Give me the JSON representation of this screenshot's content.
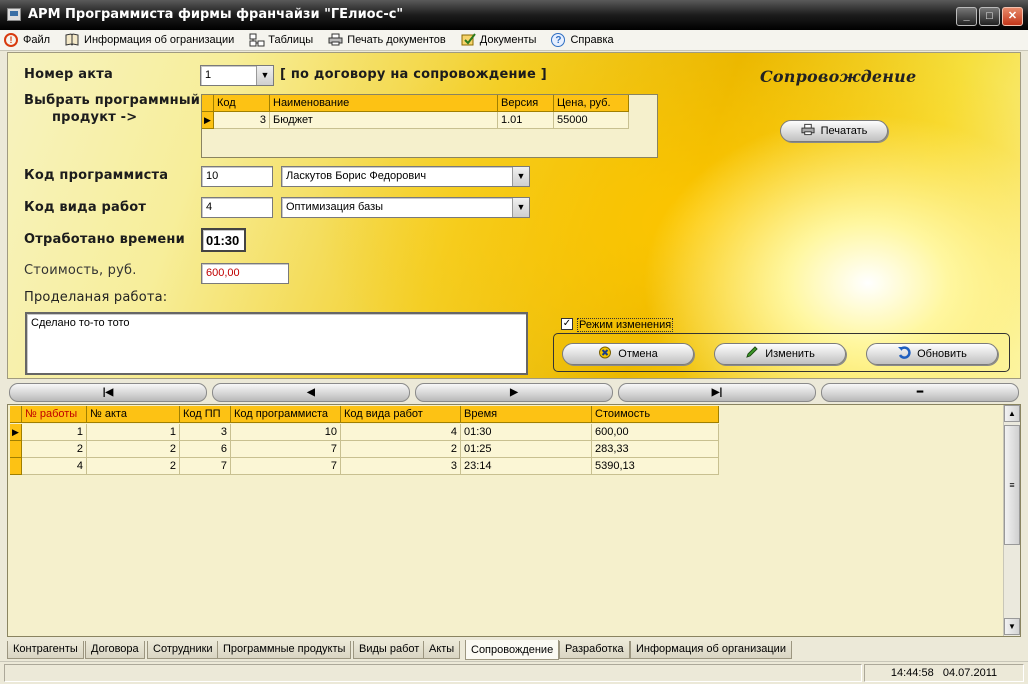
{
  "window": {
    "title": "АРМ Программиста фирмы франчайзи \"ГЕлиос-с\"",
    "buttons": {
      "minimize": "_",
      "maximize": "□",
      "close": "✕"
    }
  },
  "menu": {
    "items": [
      {
        "label": "Файл"
      },
      {
        "label": "Информация об огранизации"
      },
      {
        "label": "Таблицы"
      },
      {
        "label": "Печать документов"
      },
      {
        "label": "Документы"
      },
      {
        "label": "Справка"
      }
    ]
  },
  "form": {
    "act_number_label": "Номер акта",
    "act_number_value": "1",
    "act_note": "[ по договору на сопровождение ]",
    "heading": "Сопровождение",
    "print_button": "Печатать",
    "select_product_label_1": "Выбрать программный",
    "select_product_label_2": "продукт ->",
    "product_grid": {
      "columns": [
        "Код",
        "Наименование",
        "Версия",
        "Цена, руб."
      ],
      "rows": [
        {
          "code": "3",
          "name": "Бюджет",
          "version": "1.01",
          "price": "55000"
        }
      ]
    },
    "programmer_code_label": "Код программиста",
    "programmer_code_value": "10",
    "programmer_name": "Ласкутов Борис Федорович",
    "work_type_code_label": "Код вида работ",
    "work_type_code_value": "4",
    "work_type_name": "Оптимизация базы",
    "time_label": "Отработано времени",
    "time_value": "01:30",
    "cost_label": "Стоимость, руб.",
    "cost_value": "600,00",
    "work_done_label": "Проделаная работа:",
    "work_done_text": "Сделано то-то тото",
    "edit_mode_label": "Режим изменения",
    "edit_mode_checked": true,
    "cancel_button": "Отмена",
    "change_button": "Изменить",
    "refresh_button": "Обновить"
  },
  "navigator": {
    "first": "|◀",
    "prior": "◀",
    "next": "▶",
    "last": "▶|",
    "delete": "━"
  },
  "main_grid": {
    "columns": [
      "№ работы",
      "№ акта",
      "Код ПП",
      "Код программиста",
      "Код вида работ",
      "Время",
      "Стоимость"
    ],
    "rows": [
      [
        "1",
        "1",
        "3",
        "10",
        "4",
        "01:30",
        "600,00"
      ],
      [
        "2",
        "2",
        "6",
        "7",
        "2",
        "01:25",
        "283,33"
      ],
      [
        "4",
        "2",
        "7",
        "7",
        "3",
        "23:14",
        "5390,13"
      ]
    ]
  },
  "tabs": [
    "Контрагенты",
    "Договора",
    "Сотрудники",
    "Программные продукты",
    "Виды работ",
    "Акты",
    "Сопровождение",
    "Разработка",
    "Информация об организации"
  ],
  "active_tab": "Сопровождение",
  "status": {
    "time": "14:44:58",
    "date": "04.07.2011"
  },
  "colors": {
    "grid_header": "#fdc214",
    "accent_red": "#c00000"
  }
}
